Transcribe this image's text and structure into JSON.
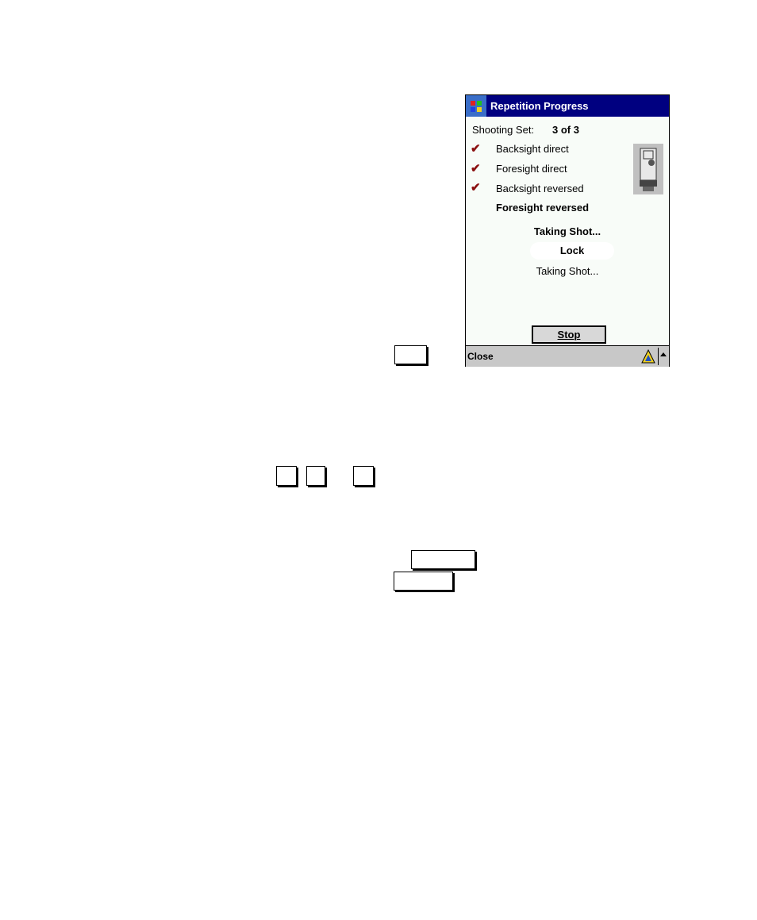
{
  "window": {
    "title": "Repetition Progress",
    "shooting_set_label": "Shooting Set:",
    "shooting_set_value": "3 of 3",
    "steps": [
      {
        "label": "Backsight direct",
        "done": true
      },
      {
        "label": "Foresight direct",
        "done": true
      },
      {
        "label": "Backsight reversed",
        "done": true
      },
      {
        "label": "Foresight reversed",
        "done": false
      }
    ],
    "status_heading": "Taking Shot...",
    "lock_label": "Lock",
    "status_text": "Taking Shot...",
    "stop_label": "Stop",
    "close_label": "Close"
  },
  "colors": {
    "title_bar": "#000080",
    "check": "#8b1010"
  }
}
